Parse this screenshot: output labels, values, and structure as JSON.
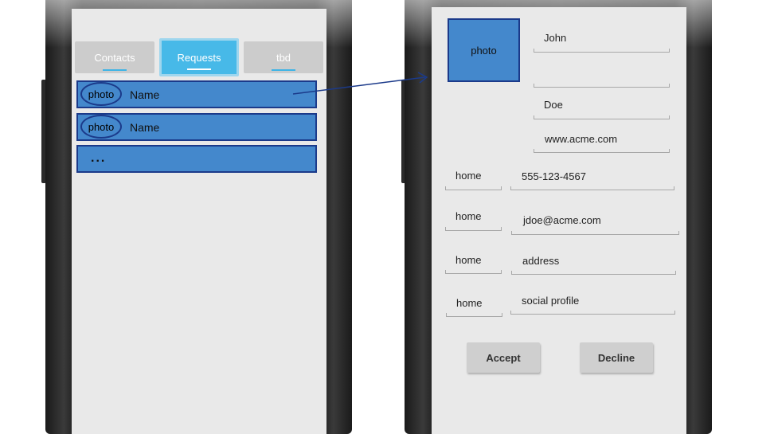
{
  "left_screen": {
    "tabs": [
      {
        "label": "Contacts",
        "active": false
      },
      {
        "label": "Requests",
        "active": true
      },
      {
        "label": "tbd",
        "active": false
      }
    ],
    "rows": [
      {
        "avatar": "photo",
        "name": "Name"
      },
      {
        "avatar": "photo",
        "name": "Name"
      },
      {
        "more": "..."
      }
    ]
  },
  "right_screen": {
    "photo_label": "photo",
    "first_name": "John",
    "middle_name": "",
    "last_name": "Doe",
    "website": "www.acme.com",
    "contact_fields": [
      {
        "type": "home",
        "value": "555-123-4567"
      },
      {
        "type": "home",
        "value": "jdoe@acme.com"
      },
      {
        "type": "home",
        "value": "address"
      },
      {
        "type": "home",
        "value": "social profile"
      }
    ],
    "accept_label": "Accept",
    "decline_label": "Decline"
  },
  "colors": {
    "row_fill": "#4488cc",
    "row_border": "#1b3a8a",
    "tab_active": "#47b9e8",
    "tab_inactive": "#cccccc",
    "screen_bg": "#e9e9e9"
  },
  "icons": {
    "arrow": "arrow-right-icon"
  }
}
